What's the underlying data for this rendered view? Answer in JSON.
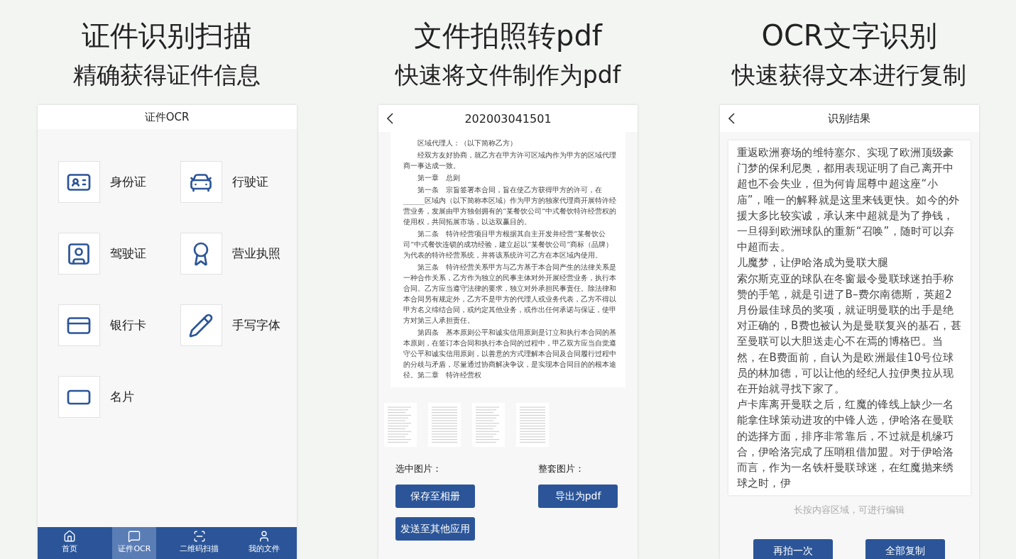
{
  "panels": [
    {
      "kind": "id_menu",
      "headline": "证件识别扫描",
      "subtitle": "精确获得证件信息",
      "title": "证件OCR",
      "items": [
        {
          "label": "身份证"
        },
        {
          "label": "行驶证"
        },
        {
          "label": "驾驶证"
        },
        {
          "label": "营业执照"
        },
        {
          "label": "银行卡"
        },
        {
          "label": "手写字体"
        },
        {
          "label": "名片"
        }
      ],
      "nav": [
        {
          "label": "首页",
          "selected": false
        },
        {
          "label": "证件OCR",
          "selected": true
        },
        {
          "label": "二维码扫描",
          "selected": false
        },
        {
          "label": "我的文件",
          "selected": false
        }
      ]
    },
    {
      "kind": "pdf",
      "headline": "文件拍照转pdf",
      "subtitle": "快速将文件制作为pdf",
      "title": "202003041501",
      "document": [
        "区域代理人：（以下简称乙方）",
        "经双方友好协商，就乙方在甲方许可区域内作为甲方的区域代理商一事达成一致。",
        "第一章　总则",
        "第一条　宗旨签署本合同，旨在使乙方获得甲方的许可，在______区域内（以下简称本区域）作为甲方的独家代理商开展特许经营业务，发展由甲方独创拥有的“某餐饮公司”中式餐饮特许经营权的使用权，共同拓展市场，以达双赢目的。",
        "第二条　特许经营项目甲方根据其自主开发并经营“某餐饮公司”中式餐饮连锁的成功经验，建立起以“某餐饮公司”商标（品牌）为代表的特许经营系统，并将该系统许可乙方在本区域内使用。",
        "第三条　特许经营关系甲方与乙方基于本合同产生的法律关系是一种合作关系，乙方作为独立的民事主体对外开展经营业务，执行本合同。乙方应当遵守法律的要求，独立对外承担民事责任。除法律和本合同另有规定外，乙方不是甲方的代理人或业务代表，乙方不得以甲方名义缔结合同，或约定其他业务，或作出任何承诺与保证，使甲方对第三人承担责任。",
        "第四条　基本原则公平和诚实信用原则是订立和执行本合同的基本原则，在签订本合同和执行本合同的过程中，甲乙双方应当自觉遵守公平和诚实信用原则，以善意的方式理解本合同及合同履行过程中的分歧与矛盾，尽量通过协商解决争议，是实现本合同目的的根本途径。第二章　特许经营权"
      ],
      "selected_label": "选中图片：",
      "selected_buttons": [
        "保存至相册",
        "发送至其他应用"
      ],
      "set_label": "整套图片：",
      "set_buttons": [
        "导出为pdf"
      ]
    },
    {
      "kind": "result",
      "headline": "OCR文字识别",
      "subtitle": "快速获得文本进行复制",
      "title": "识别结果",
      "text": [
        "重返欧洲赛场的维特塞尔、实现了欧洲顶级豪门梦的保利尼奥，都用表现证明了自己离开中超也不会失业，但为何肯屈尊中超这座“小庙”，唯一的解释就是这里来钱更快。如今的外援大多比较实诚，承认来中超就是为了挣钱，一旦得到欧洲球队的重新“召唤”，随时可以弃中超而去。",
        "儿魔梦，让伊哈洛成为曼联大腿",
        "索尔斯克亚的球队在冬窗最令曼联球迷拍手称赞的手笔，就是引进了B–费尔南德斯，英超2月份最佳球员的奖项，就证明曼联的出手是绝对正确的，B费也被认为是曼联复兴的基石，甚至曼联可以大胆送走心不在焉的博格巴。当然，在B费面前，自认为是欧洲最佳10号位球员的林加德，可以让他的经纪人拉伊奥拉从现在开始就寻找下家了。",
        "卢卡库离开曼联之后，红魔的锋线上缺少一名能拿住球策动进攻的中锋人选，伊哈洛在曼联的选择方面，排序非常靠后，不过就是机缘巧合，伊哈洛完成了压哨租借加盟。对于伊哈洛而言，作为一名铁杆曼联球迷，在红魔抛来绣球之时，伊"
      ],
      "hint": "长按内容区域，可进行编辑",
      "buttons": [
        "再拍一次",
        "全部复制"
      ]
    }
  ]
}
